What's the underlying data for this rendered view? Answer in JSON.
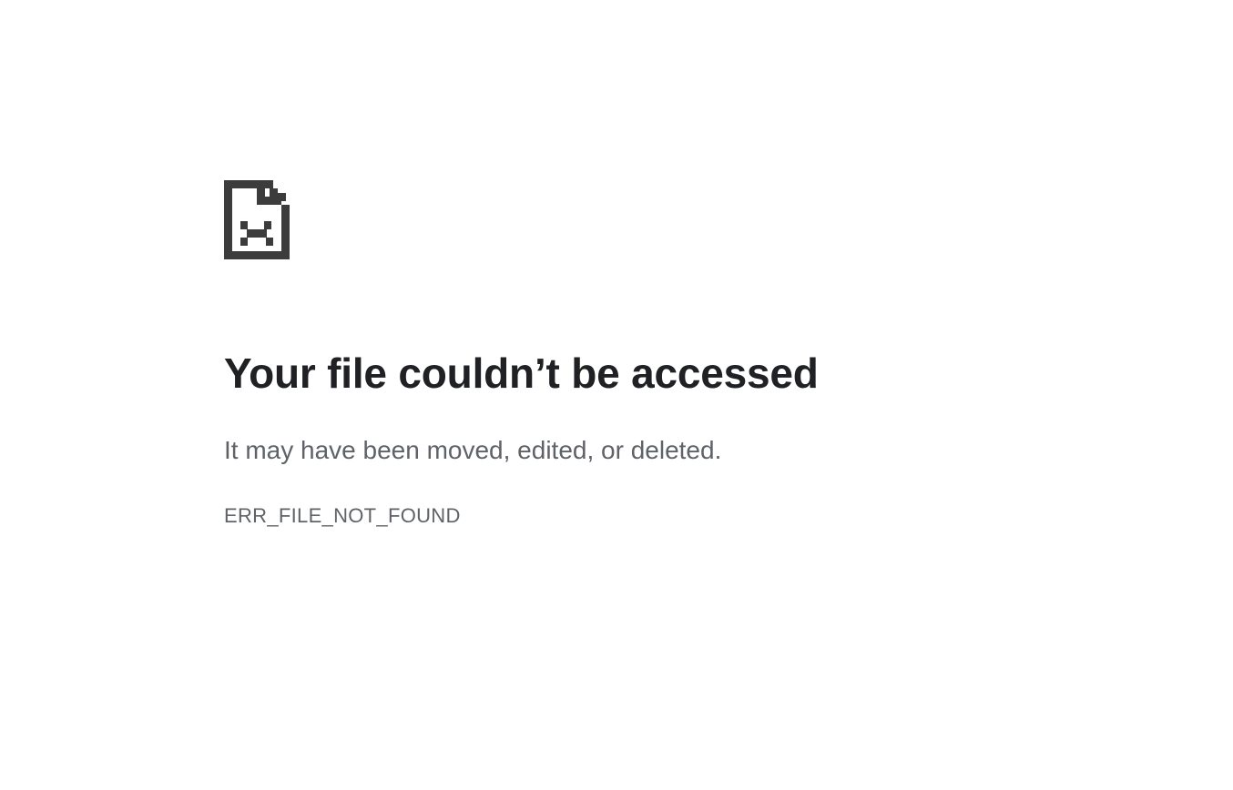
{
  "error": {
    "icon": "sad-file-icon",
    "title": "Your file couldn’t be accessed",
    "subtitle": "It may have been moved, edited, or deleted.",
    "code": "ERR_FILE_NOT_FOUND"
  },
  "colors": {
    "background": "#ffffff",
    "title": "#202124",
    "body_text": "#5f6368",
    "icon": "#3c3c3c"
  }
}
